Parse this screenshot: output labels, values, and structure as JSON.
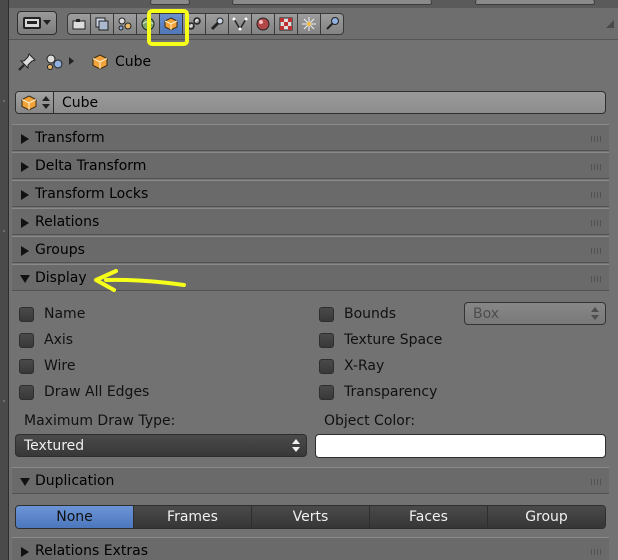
{
  "breadcrumb": {
    "object_name": "Cube"
  },
  "object_field": {
    "value": "Cube"
  },
  "panels": {
    "transform": "Transform",
    "delta_transform": "Delta Transform",
    "transform_locks": "Transform Locks",
    "relations": "Relations",
    "groups": "Groups",
    "display": "Display",
    "duplication": "Duplication",
    "relations_extras": "Relations Extras"
  },
  "display": {
    "left_checks": [
      "Name",
      "Axis",
      "Wire",
      "Draw All Edges"
    ],
    "right_checks": [
      "Bounds",
      "Texture Space",
      "X-Ray",
      "Transparency"
    ],
    "bounds_type": "Box",
    "max_draw_type_label": "Maximum Draw Type:",
    "max_draw_type_value": "Textured",
    "object_color_label": "Object Color:",
    "object_color": "#ffffff"
  },
  "duplication": {
    "options": [
      "None",
      "Frames",
      "Verts",
      "Faces",
      "Group"
    ],
    "selected": "None"
  },
  "tabs": [
    "render-icon",
    "render-layers-icon",
    "scene-icon",
    "world-icon",
    "object-icon",
    "constraints-icon",
    "modifiers-icon",
    "mesh-data-icon",
    "material-icon",
    "texture-icon",
    "particles-icon",
    "physics-icon"
  ],
  "active_tab": "object-icon",
  "colors": {
    "highlight": "#f6ff1a",
    "accent": "#5a84c8"
  }
}
